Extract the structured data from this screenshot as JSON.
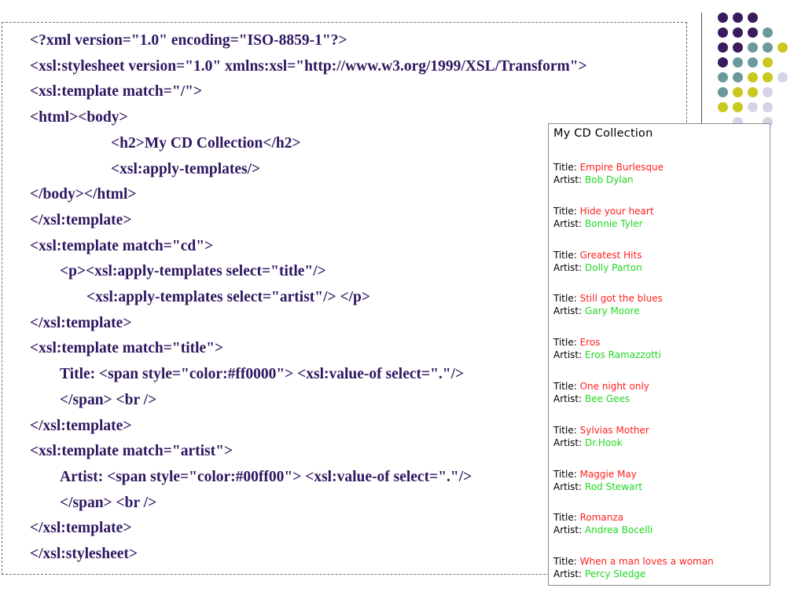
{
  "code_lines": [
    {
      "text": "<?xml version=\"1.0\" encoding=\"ISO-8859-1\"?>"
    },
    {
      "text": "<xsl:stylesheet version=\"1.0\" xmlns:xsl=\"http://www.w3.org/1999/XSL/Transform\">"
    },
    {
      "text": "<xsl:template match=\"/\">"
    },
    {
      "text": "<html><body>"
    },
    {
      "text": "<h2>My CD Collection</h2>"
    },
    {
      "text": "<xsl:apply-templates/>"
    },
    {
      "text": "</body></html>"
    },
    {
      "text": "</xsl:template>"
    },
    {
      "text": "<xsl:template match=\"cd\">"
    },
    {
      "text": "<p><xsl:apply-templates select=\"title\"/>"
    },
    {
      "text": "<xsl:apply-templates select=\"artist\"/> </p>"
    },
    {
      "text": "</xsl:template>"
    },
    {
      "text": "<xsl:template match=\"title\">"
    },
    {
      "text": "Title: <span style=\"color:#ff0000\"> <xsl:value-of select=\".\"/>"
    },
    {
      "text": "</span> <br />"
    },
    {
      "text": "</xsl:template>"
    },
    {
      "text": "<xsl:template match=\"artist\">"
    },
    {
      "text": "Artist: <span style=\"color:#00ff00\"> <xsl:value-of select=\".\"/>"
    },
    {
      "text": "</span> <br />"
    },
    {
      "text": "</xsl:template>"
    },
    {
      "text": "</xsl:stylesheet>"
    }
  ],
  "browser": {
    "heading": "My CD Collection",
    "title_label": "Title:",
    "artist_label": "Artist:",
    "cds": [
      {
        "title": "Empire Burlesque",
        "artist": "Bob Dylan"
      },
      {
        "title": "Hide your heart",
        "artist": "Bonnie Tyler"
      },
      {
        "title": "Greatest Hits",
        "artist": "Dolly Parton"
      },
      {
        "title": "Still got the blues",
        "artist": "Gary Moore"
      },
      {
        "title": "Eros",
        "artist": "Eros Ramazzotti"
      },
      {
        "title": "One night only",
        "artist": "Bee Gees"
      },
      {
        "title": "Sylvias Mother",
        "artist": "Dr.Hook"
      },
      {
        "title": "Maggie May",
        "artist": "Rod Stewart"
      },
      {
        "title": "Romanza",
        "artist": "Andrea Bocelli"
      },
      {
        "title": "When a man loves a woman",
        "artist": "Percy Sledge"
      }
    ]
  },
  "colors": {
    "code_text": "#2e1760",
    "title_red": "#ff2020",
    "artist_green": "#20d820",
    "dot_purple": "#3b1a5e",
    "dot_teal": "#6b9a9c",
    "dot_yellow": "#c8c81e",
    "dot_lavender": "#d4d4e6"
  }
}
